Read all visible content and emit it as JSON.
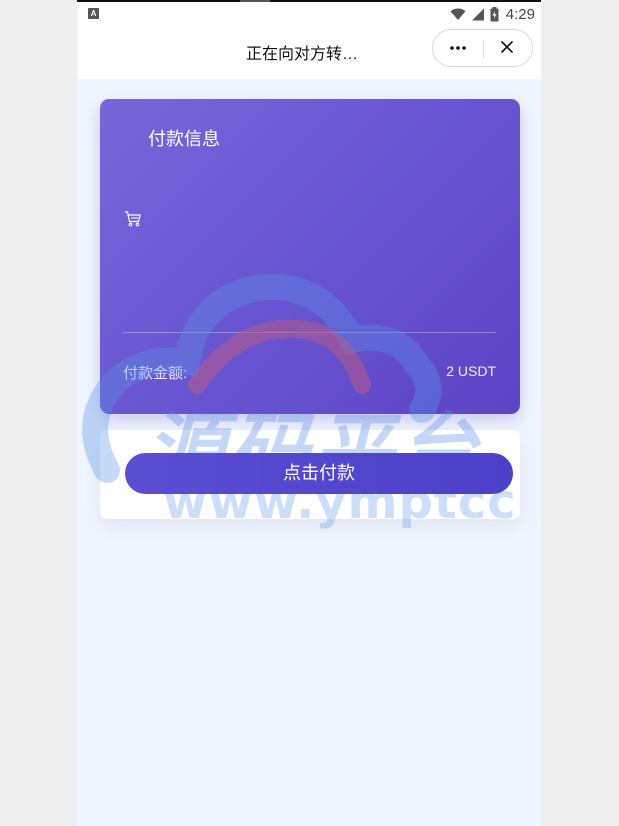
{
  "status_bar": {
    "time": "4:29",
    "left_badge": "A",
    "icons": [
      "wifi-icon",
      "signal-icon",
      "battery-icon"
    ]
  },
  "nav": {
    "title": "正在向对方转…",
    "more_icon": "more-dots-icon",
    "close_icon": "close-icon"
  },
  "card": {
    "title": "付款信息",
    "icon": "cart-icon",
    "amount_label": "付款金额:",
    "amount_value": "2 USDT"
  },
  "pay_button_label": "点击付款",
  "watermark": {
    "line1": "源码平台",
    "line2": "www.ymptcc"
  },
  "colors": {
    "card_gradient_start": "#7667d9",
    "card_gradient_end": "#5c44c6",
    "button": "#4c3fc9",
    "page_background": "#f0f6fe"
  }
}
